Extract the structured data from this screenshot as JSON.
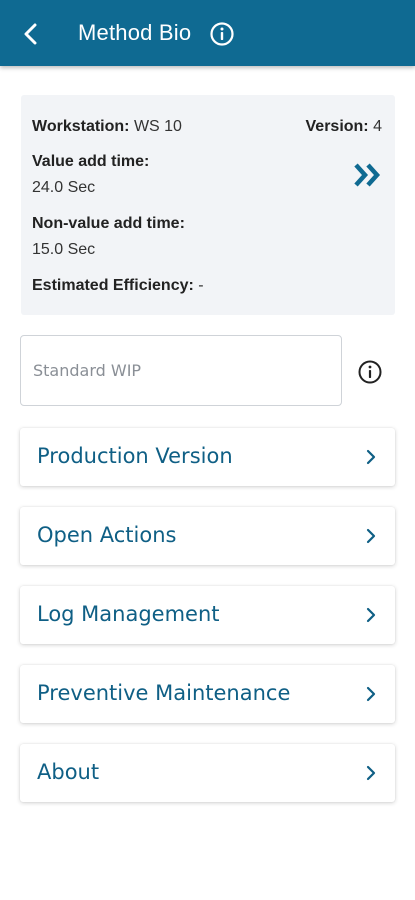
{
  "header": {
    "title": "Method Bio",
    "back_icon": "back-arrow-icon",
    "info_icon": "info-icon"
  },
  "summary": {
    "workstation_label": "Workstation:",
    "workstation_value": "WS 10",
    "version_label": "Version:",
    "version_value": "4",
    "value_add_label": "Value add time:",
    "value_add_value": "24.0 Sec",
    "non_value_add_label": "Non-value add time:",
    "non_value_add_value": "15.0 Sec",
    "efficiency_label": "Estimated Efficiency:",
    "efficiency_value": "-",
    "more_icon": "double-chevron-right-icon"
  },
  "wip": {
    "placeholder": "Standard WIP",
    "value": "",
    "info_icon": "info-icon"
  },
  "menu": {
    "items": [
      {
        "label": "Production Version"
      },
      {
        "label": "Open Actions"
      },
      {
        "label": "Log Management"
      },
      {
        "label": "Preventive Maintenance"
      },
      {
        "label": "About"
      }
    ],
    "chevron_icon": "chevron-right-icon"
  },
  "colors": {
    "primary": "#0f6a92",
    "menu_text": "#0f5f85",
    "summary_bg": "#f2f4f7"
  }
}
